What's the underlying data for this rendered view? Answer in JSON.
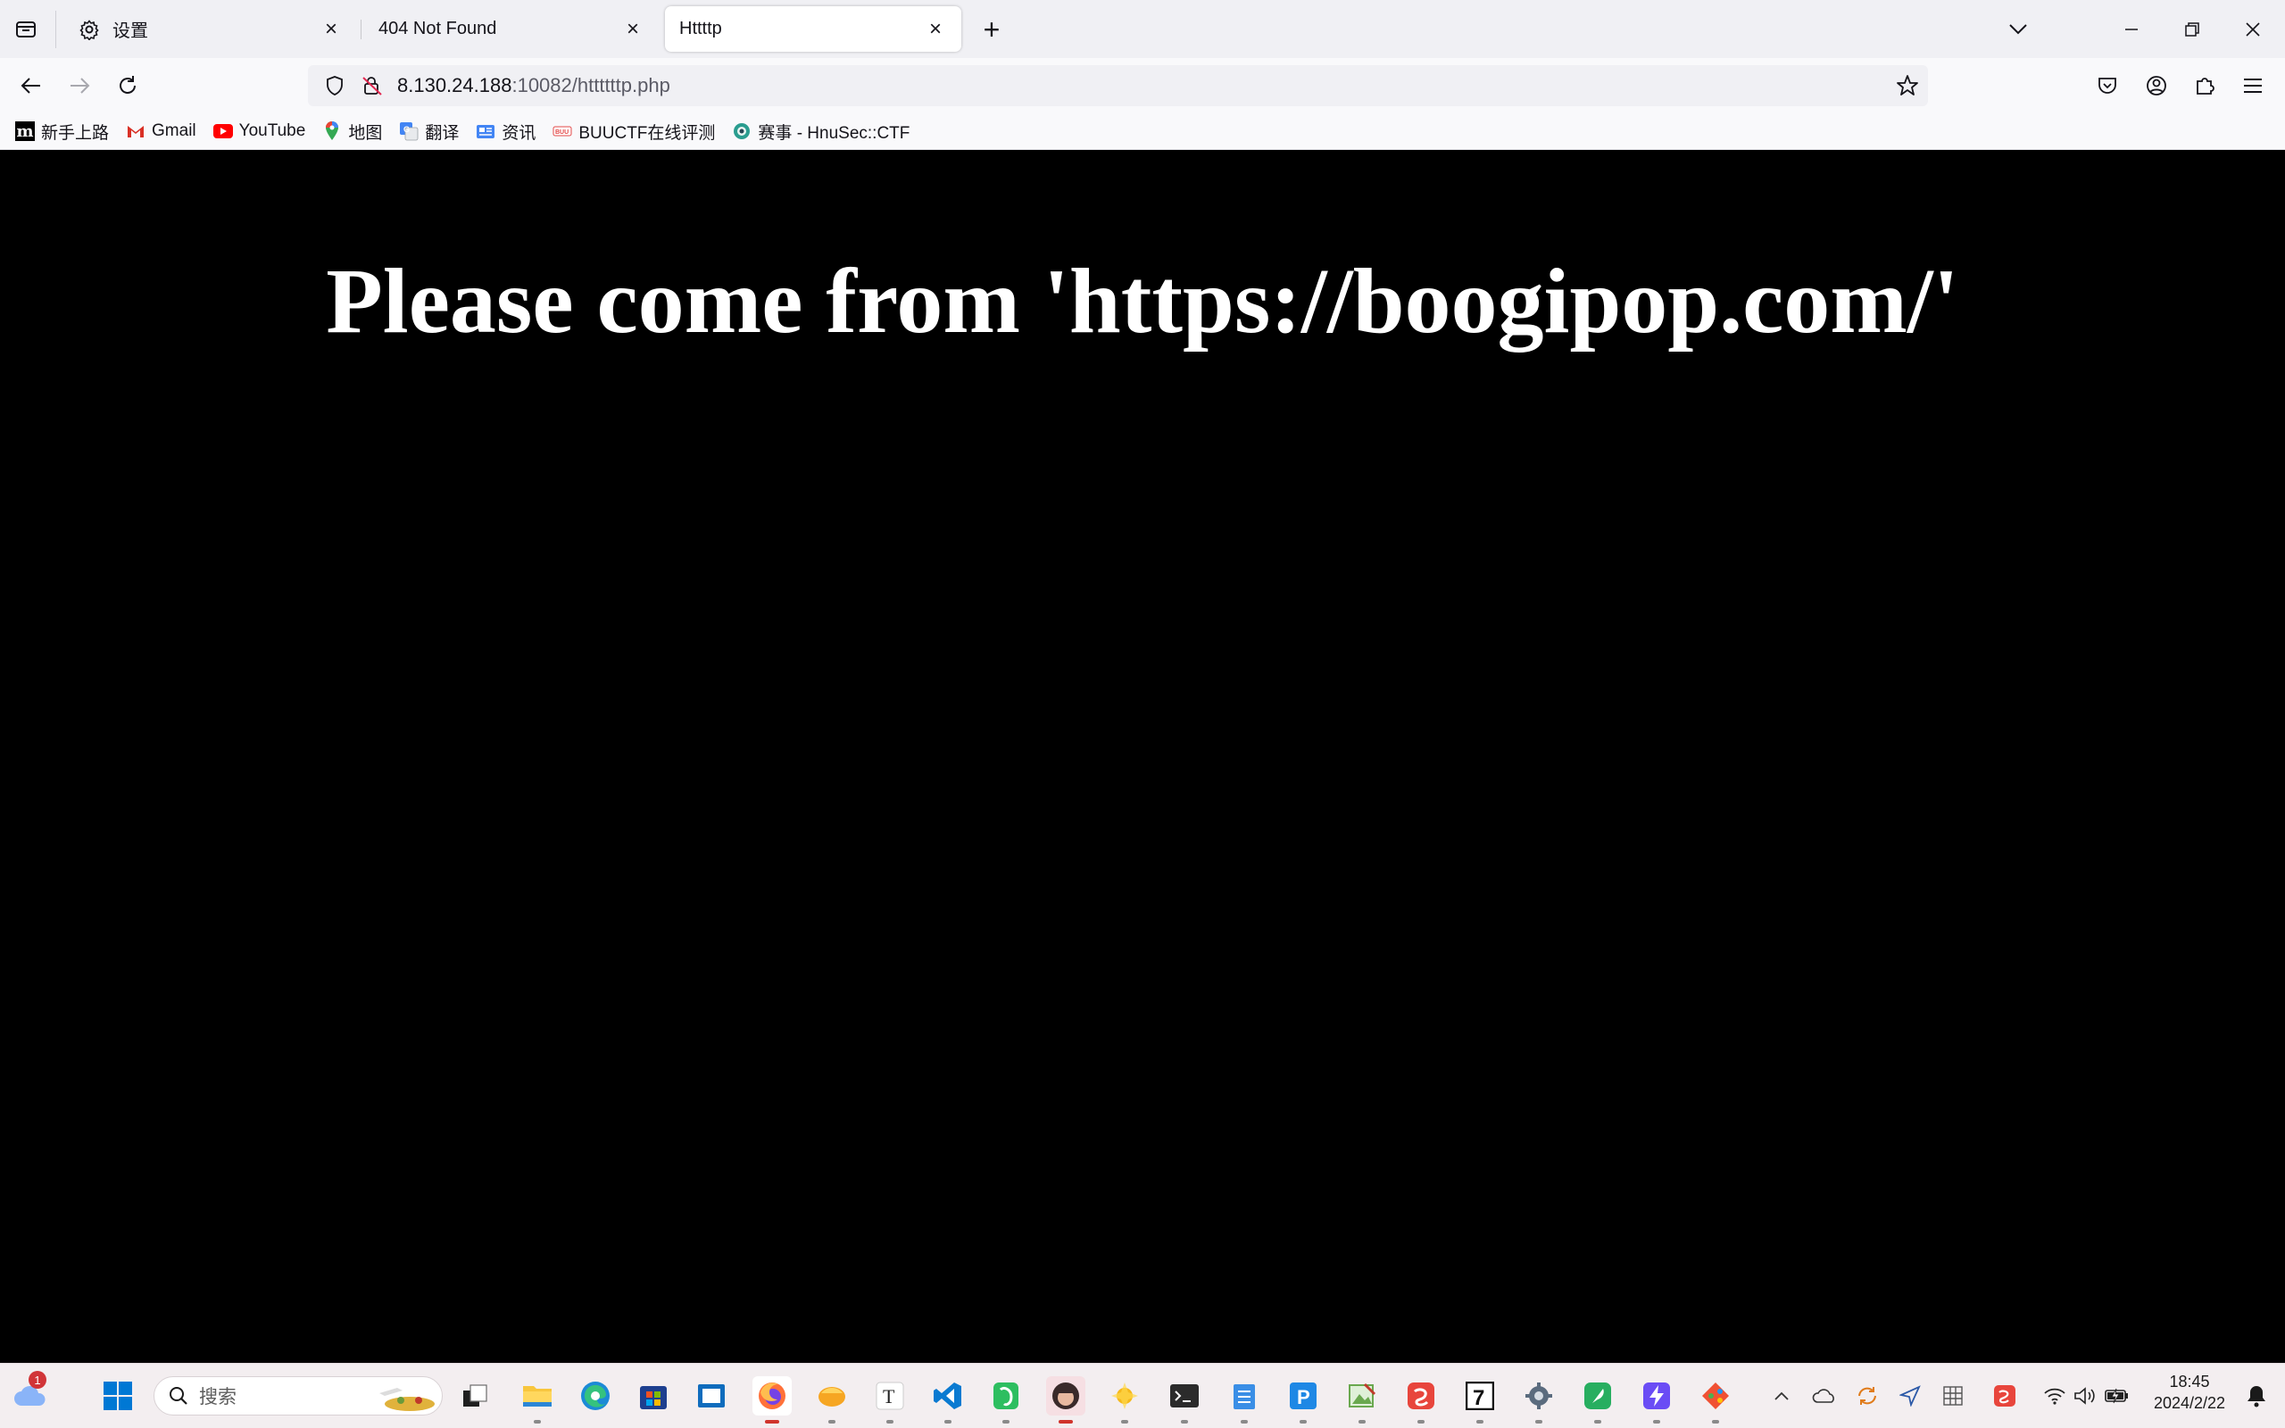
{
  "tabs": [
    {
      "title": "设置",
      "icon": "gear-icon"
    },
    {
      "title": "404 Not Found"
    },
    {
      "title": "Httttp",
      "active": true
    }
  ],
  "address": {
    "host": "8.130.24.188",
    "rest": ":10082/httttttp.php"
  },
  "bookmarks": [
    {
      "label": "新手上路",
      "icon": "mdn-icon"
    },
    {
      "label": "Gmail",
      "icon": "gmail-icon"
    },
    {
      "label": "YouTube",
      "icon": "youtube-icon"
    },
    {
      "label": "地图",
      "icon": "maps-icon"
    },
    {
      "label": "翻译",
      "icon": "translate-icon"
    },
    {
      "label": "资讯",
      "icon": "news-icon"
    },
    {
      "label": "BUUCTF在线评测",
      "icon": "buuctf-icon"
    },
    {
      "label": "赛事 - HnuSec::CTF",
      "icon": "hnusec-icon"
    }
  ],
  "page": {
    "headline": "Please come from 'https://boogipop.com/'"
  },
  "taskbar": {
    "weather_badge": "1",
    "search_placeholder": "搜索",
    "apps": [
      "file-explorer",
      "edge",
      "microsoft-store",
      "whiteboard",
      "firefox",
      "mango-app",
      "typora",
      "vscode",
      "evernote",
      "avatar-app",
      "pinwheel-app",
      "terminal",
      "notepad",
      "p-app",
      "photo-app",
      "wps",
      "7zip",
      "settings",
      "feather-app",
      "bolt-app",
      "git-app"
    ],
    "active_app": "firefox"
  },
  "clock": {
    "time": "18:45",
    "date": "2024/2/22"
  },
  "colors": {
    "page_background": "#000000",
    "headline": "#ffffff",
    "tabstrip": "#f0f0f4",
    "taskbar": "#f3eef0"
  }
}
